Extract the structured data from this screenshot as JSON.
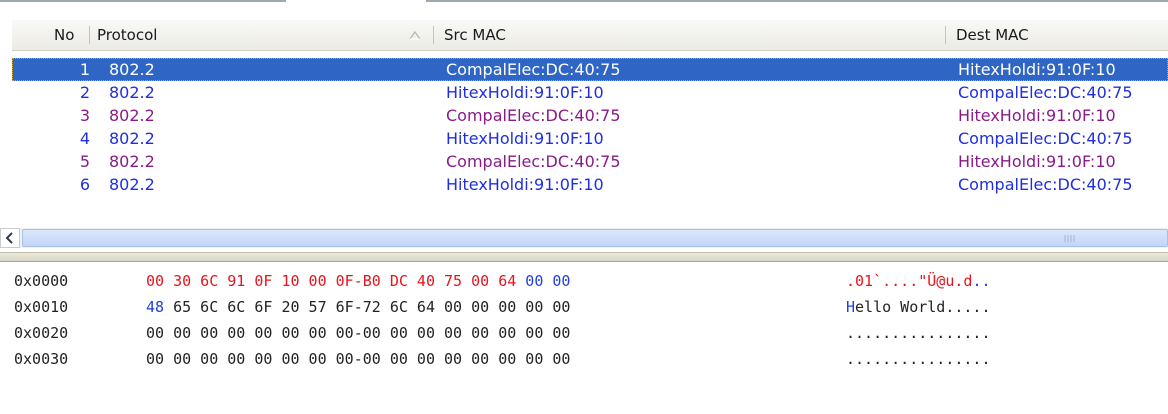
{
  "columns": {
    "no": "No",
    "protocol": "Protocol",
    "src_mac": "Src MAC",
    "dest_mac": "Dest MAC"
  },
  "colors": {
    "selected_row_bg": "#2f66c6",
    "blue_row": "#1f2ee0",
    "purple_row": "#8a1a8a",
    "hex_red": "#e6141e",
    "hex_blue": "#1f3ee0"
  },
  "packets": [
    {
      "no": "1",
      "protocol": "802.2",
      "src": "CompalElec:DC:40:75",
      "dest": "HitexHoldi:91:0F:10",
      "color": "#ffffff",
      "selected": true
    },
    {
      "no": "2",
      "protocol": "802.2",
      "src": "HitexHoldi:91:0F:10",
      "dest": "CompalElec:DC:40:75",
      "color": "#1f2ee0",
      "selected": false
    },
    {
      "no": "3",
      "protocol": "802.2",
      "src": "CompalElec:DC:40:75",
      "dest": "HitexHoldi:91:0F:10",
      "color": "#8a1a8a",
      "selected": false
    },
    {
      "no": "4",
      "protocol": "802.2",
      "src": "HitexHoldi:91:0F:10",
      "dest": "CompalElec:DC:40:75",
      "color": "#1f2ee0",
      "selected": false
    },
    {
      "no": "5",
      "protocol": "802.2",
      "src": "CompalElec:DC:40:75",
      "dest": "HitexHoldi:91:0F:10",
      "color": "#8a1a8a",
      "selected": false
    },
    {
      "no": "6",
      "protocol": "802.2",
      "src": "HitexHoldi:91:0F:10",
      "dest": "CompalElec:DC:40:75",
      "color": "#1f2ee0",
      "selected": false
    }
  ],
  "hex": [
    {
      "addr": "0x0000",
      "bytes": [
        {
          "t": "00 30 6C 91 0F 10 00 0F-B0 DC 40 75 00 64 ",
          "c": "red"
        },
        {
          "t": "00 00",
          "c": "blue"
        }
      ],
      "ascii": [
        {
          "t": ".01`....\"Ü@u.d",
          "c": "red"
        },
        {
          "t": "..",
          "c": "blue"
        }
      ]
    },
    {
      "addr": "0x0010",
      "bytes": [
        {
          "t": "48 ",
          "c": "blue"
        },
        {
          "t": "65 6C 6C 6F 20 57 6F-72 6C 64 00 00 00 00 00",
          "c": "dark"
        }
      ],
      "ascii": [
        {
          "t": "H",
          "c": "blue"
        },
        {
          "t": "ello World.....",
          "c": "dark"
        }
      ]
    },
    {
      "addr": "0x0020",
      "bytes": [
        {
          "t": "00 00 00 00 00 00 00 00-00 00 00 00 00 00 00 00",
          "c": "dark"
        }
      ],
      "ascii": [
        {
          "t": "................",
          "c": "dark"
        }
      ]
    },
    {
      "addr": "0x0030",
      "bytes": [
        {
          "t": "00 00 00 00 00 00 00 00-00 00 00 00 00 00 00 00",
          "c": "dark"
        }
      ],
      "ascii": [
        {
          "t": "................",
          "c": "dark"
        }
      ]
    }
  ]
}
